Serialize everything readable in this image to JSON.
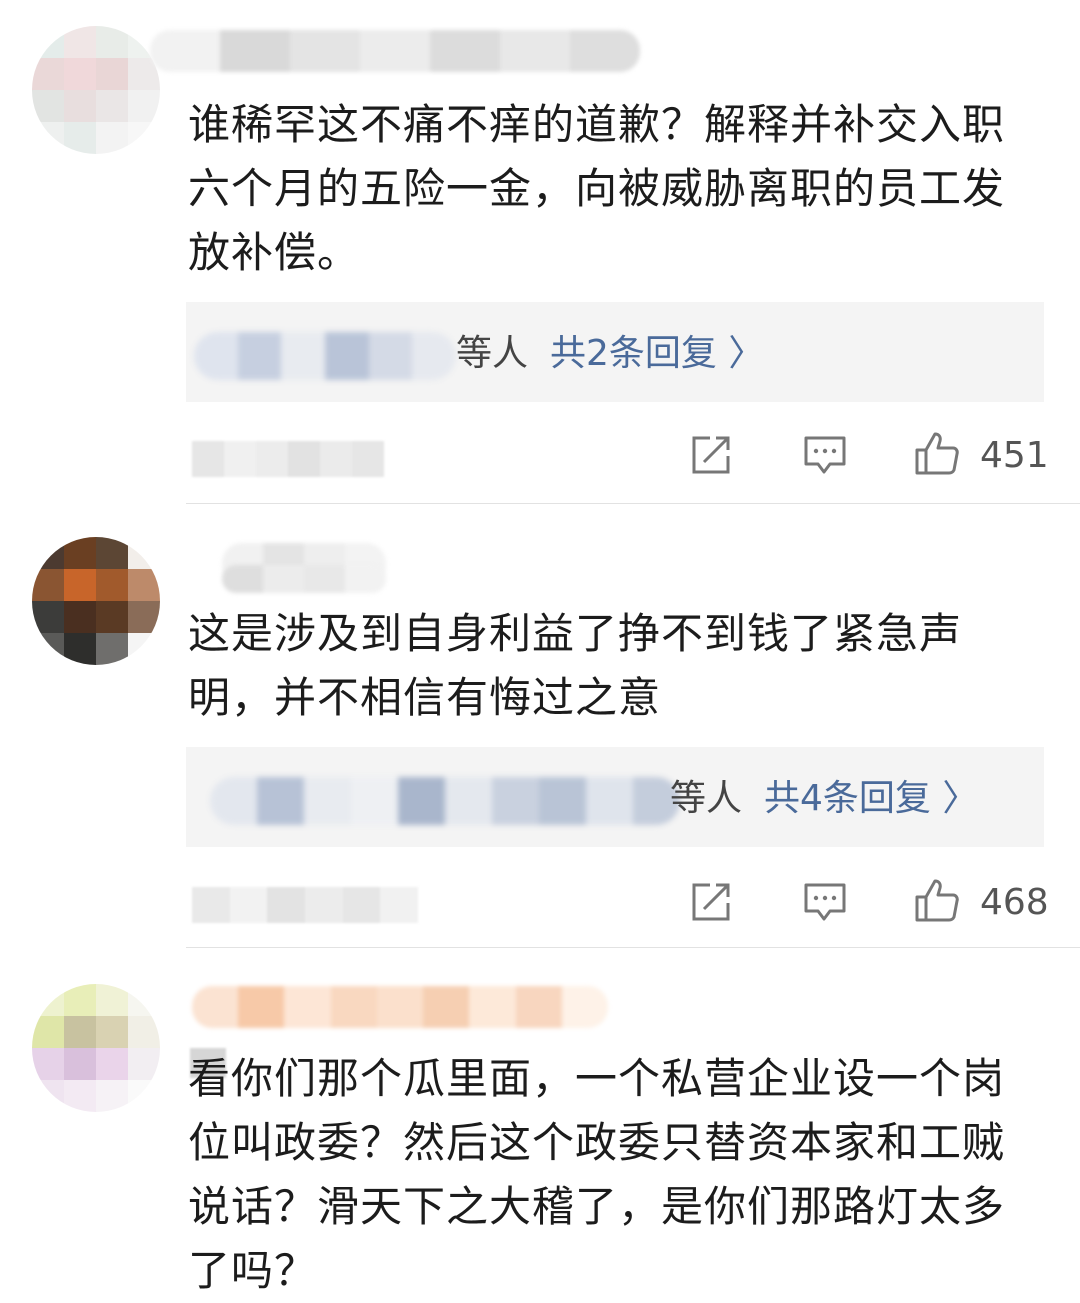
{
  "comments": [
    {
      "text_lines": [
        "谁稀罕这不痛不痒的道歉？解释并补交入职",
        "六个月的五险一金，向被威胁离职的员工发",
        "放补偿。"
      ],
      "reply_suffix": "等人",
      "reply_count": "共2条回复 〉",
      "like_count": "451"
    },
    {
      "text_lines": [
        "这是涉及到自身利益了挣不到钱了紧急声",
        "明，并不相信有悔过之意"
      ],
      "reply_suffix": "等人",
      "reply_count": "共4条回复 〉",
      "like_count": "468"
    },
    {
      "text_lines": [
        "看你们那个瓜里面，一个私营企业设一个岗",
        "位叫政委？然后这个政委只替资本家和工贼",
        "说话？滑天下之大稽了，是你们那路灯太多",
        "了吗？"
      ]
    }
  ],
  "icons": {
    "share": "share-icon",
    "comment": "comment-icon",
    "like": "thumbs-up-icon"
  },
  "colors": {
    "reply_link": "#4a6a9a",
    "reply_bg": "#f4f4f4",
    "divider": "#e2e2e2"
  }
}
